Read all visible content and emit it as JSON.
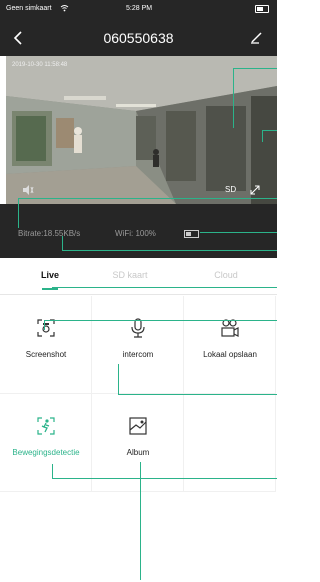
{
  "status_bar": {
    "carrier": "Geen simkaart",
    "time": "5:28 PM"
  },
  "nav": {
    "title": "060550638"
  },
  "video": {
    "timestamp": "2019-10-30 11:58:48",
    "sd_label": "SD"
  },
  "info": {
    "bitrate": "Bitrate:18.55KB/s",
    "wifi": "WiFi: 100%"
  },
  "tabs": [
    {
      "label": "Live"
    },
    {
      "label": "SD kaart"
    },
    {
      "label": "Cloud"
    }
  ],
  "actions": [
    {
      "label": "Screenshot",
      "icon": "screenshot-icon"
    },
    {
      "label": "intercom",
      "icon": "microphone-icon"
    },
    {
      "label": "Lokaal opslaan",
      "icon": "local-record-icon"
    },
    {
      "label": "Bewegingsdetectie",
      "icon": "motion-detection-icon"
    },
    {
      "label": "Album",
      "icon": "album-icon"
    }
  ],
  "colors": {
    "accent": "#2bb38a",
    "dark_bar": "#262626"
  }
}
